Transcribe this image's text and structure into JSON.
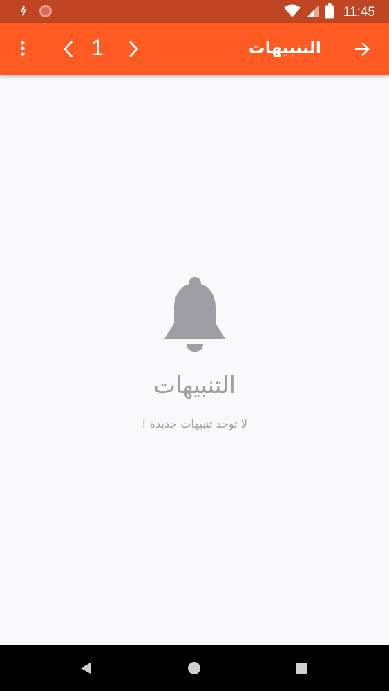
{
  "status_bar": {
    "time": "11:45",
    "icons": [
      "notification-icon",
      "app-notification-icon",
      "wifi-icon",
      "signal-icon",
      "battery-icon"
    ]
  },
  "app_bar": {
    "title": "التنبيهات",
    "page_number": "1",
    "background_color": "#ff5a22",
    "icons": [
      "more-vert-icon",
      "chevron-left-icon",
      "chevron-right-icon",
      "arrow-forward-icon"
    ]
  },
  "empty_state": {
    "icon": "bell-icon",
    "title": "التنبيهات",
    "message": "لا توجد تنبيهات جديدة !",
    "text_color": "#9e9ea4"
  },
  "nav_bar": {
    "icons": [
      "back-icon",
      "home-icon",
      "recents-icon"
    ]
  }
}
